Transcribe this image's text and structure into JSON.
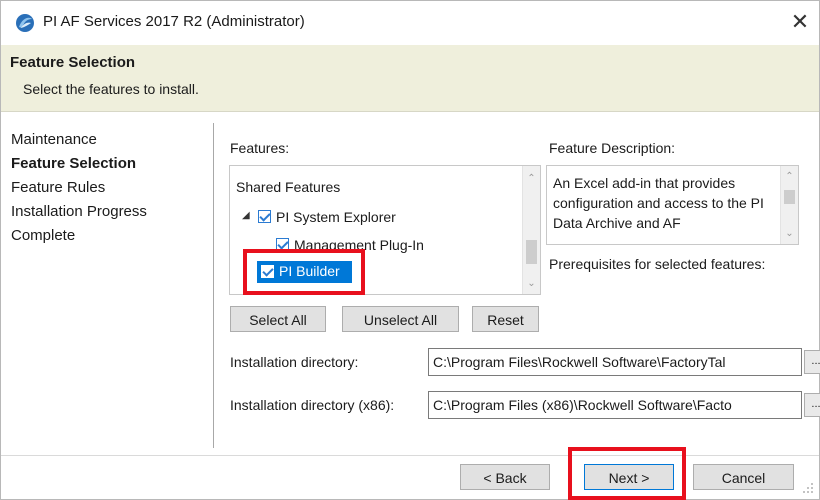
{
  "window": {
    "title": "PI AF Services 2017 R2 (Administrator)",
    "close_glyph": "✕"
  },
  "banner": {
    "title": "Feature Selection",
    "subtitle": "Select the features to install."
  },
  "nav": {
    "items": [
      {
        "label": "Maintenance",
        "active": false
      },
      {
        "label": "Feature Selection",
        "active": true
      },
      {
        "label": "Feature Rules",
        "active": false
      },
      {
        "label": "Installation Progress",
        "active": false
      },
      {
        "label": "Complete",
        "active": false
      }
    ]
  },
  "features": {
    "label": "Features:",
    "tree": [
      {
        "label": "Shared Features",
        "checked": null
      },
      {
        "label": "PI System Explorer",
        "checked": true,
        "expanded": true
      },
      {
        "label": "Management Plug-In",
        "checked": true
      },
      {
        "label": "PI Builder",
        "checked": true,
        "selected": true
      }
    ]
  },
  "description": {
    "label": "Feature Description:",
    "text": "An Excel add-in that provides configuration and access to the PI Data Archive and AF",
    "prereq_label": "Prerequisites for selected features:"
  },
  "buttons": {
    "select_all": "Select All",
    "unselect_all": "Unselect All",
    "reset": "Reset"
  },
  "install_dir": {
    "label": "Installation directory:",
    "value": "C:\\Program Files\\Rockwell Software\\FactoryTal",
    "browse": "..."
  },
  "install_dir_x86": {
    "label": "Installation directory (x86):",
    "value": "C:\\Program Files (x86)\\Rockwell Software\\Facto",
    "browse": "..."
  },
  "footer": {
    "back": "< Back",
    "next": "Next >",
    "cancel": "Cancel"
  },
  "colors": {
    "accent": "#0078d7",
    "banner_bg": "#efefdc",
    "highlight": "#e8101d",
    "selection": "#0078d7"
  },
  "icons": {
    "app": "pi-logo-icon",
    "close": "close-icon",
    "expand": "expand-triangle-icon",
    "check": "checkbox-icon",
    "resize": "resize-grip-icon"
  }
}
